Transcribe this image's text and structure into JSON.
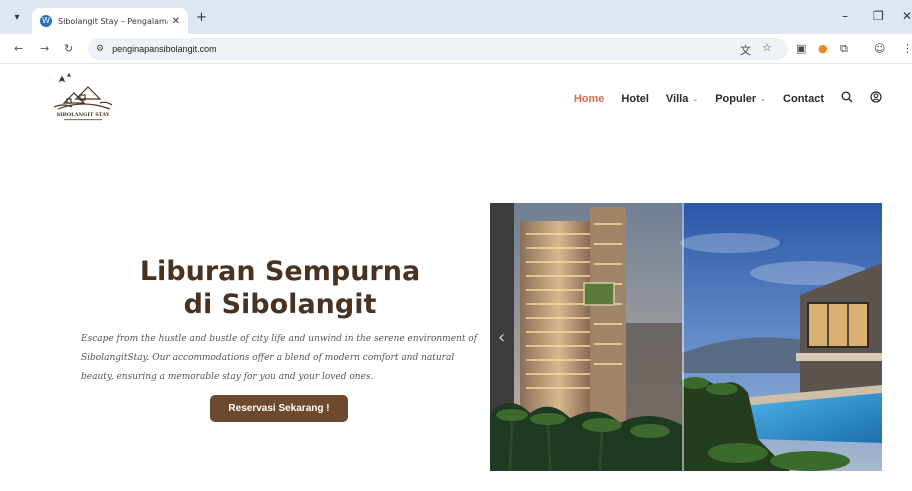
{
  "browser": {
    "tab_title": "Sibolangit Stay – Pengalaman M",
    "url": "penginapansibolangit.com",
    "icons": [
      "tab-list-icon",
      "wordpress-favicon-icon",
      "close-icon",
      "plus-icon",
      "minimize-icon",
      "restore-icon",
      "close-window-icon",
      "back-icon",
      "forward-icon",
      "reload-icon",
      "site-info-icon",
      "translate-icon",
      "bookmark-star-icon",
      "extension-icon",
      "profile-icon",
      "menu-icon"
    ]
  },
  "site": {
    "nav": [
      {
        "label": "Home",
        "active": true,
        "dropdown": false
      },
      {
        "label": "Hotel",
        "active": false,
        "dropdown": false
      },
      {
        "label": "Villa",
        "active": false,
        "dropdown": true
      },
      {
        "label": "Populer",
        "active": false,
        "dropdown": true
      },
      {
        "label": "Contact",
        "active": false,
        "dropdown": false
      }
    ],
    "hero": {
      "title_line1": "Liburan Sempurna",
      "title_line2": "di Sibolangit",
      "description": "Escape from the hustle and bustle of city life and unwind in the serene environment of SibolangitStay. Our accommodations offer a blend of modern comfort and natural beauty, ensuring a memorable stay for you and your loved ones.",
      "cta_label": "Reservasi Sekarang !"
    },
    "colors": {
      "accent_active": "#d96a4f",
      "brand_brown": "#6d4a2e",
      "title_brown": "#4a3221"
    }
  }
}
